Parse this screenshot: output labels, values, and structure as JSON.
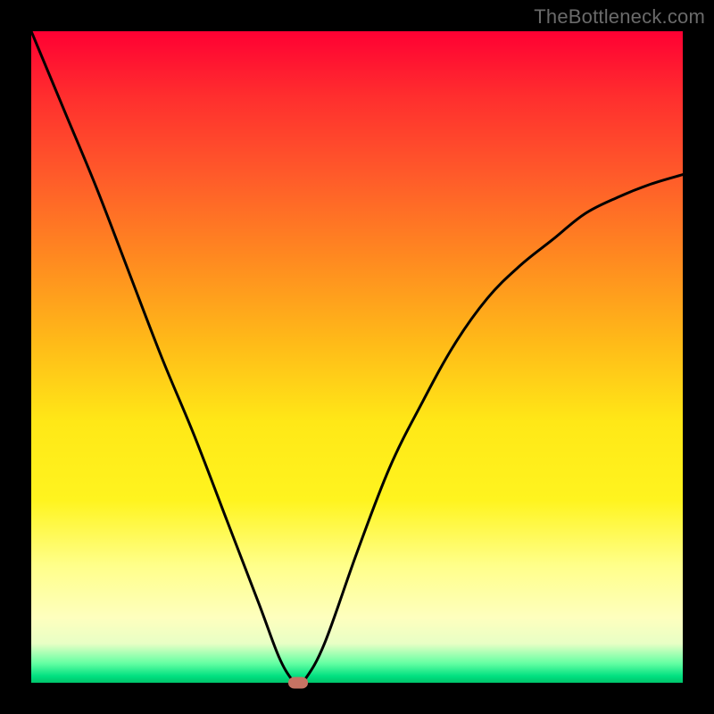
{
  "watermark": "TheBottleneck.com",
  "chart_data": {
    "type": "line",
    "title": "",
    "xlabel": "",
    "ylabel": "",
    "xlim": [
      0,
      100
    ],
    "ylim": [
      0,
      100
    ],
    "grid": false,
    "legend": false,
    "series": [
      {
        "name": "curve",
        "x": [
          0,
          5,
          10,
          15,
          20,
          25,
          30,
          35,
          38,
          40,
          41,
          42,
          45,
          50,
          55,
          60,
          65,
          70,
          75,
          80,
          85,
          90,
          95,
          100
        ],
        "y": [
          100,
          88,
          76,
          63,
          50,
          38,
          25,
          12,
          4,
          0.5,
          0,
          0.5,
          6,
          20,
          33,
          43,
          52,
          59,
          64,
          68,
          72,
          74.5,
          76.5,
          78
        ]
      }
    ],
    "marker": {
      "x": 41,
      "y": 0
    },
    "colors": {
      "curve": "#000000",
      "marker": "#c57363",
      "frame": "#000000",
      "gradient_top": "#ff0033",
      "gradient_bottom": "#00c46a"
    }
  }
}
